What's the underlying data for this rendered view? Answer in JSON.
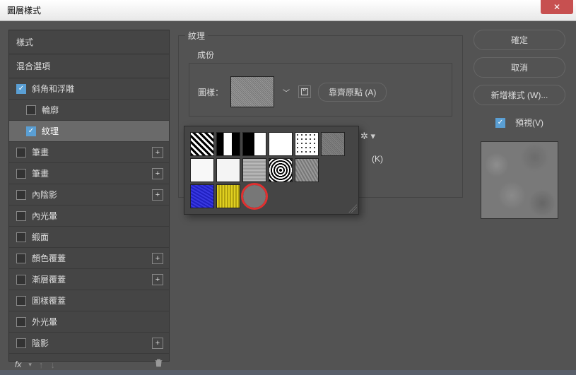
{
  "window": {
    "title": "圖層樣式"
  },
  "left": {
    "styles_header": "樣式",
    "blending_options": "混合選項",
    "items": [
      {
        "label": "斜角和浮雕",
        "checked": true,
        "selected": false,
        "indent": false,
        "add": false
      },
      {
        "label": "輪廓",
        "checked": false,
        "selected": false,
        "indent": true,
        "add": false
      },
      {
        "label": "紋理",
        "checked": true,
        "selected": true,
        "indent": true,
        "add": false
      },
      {
        "label": "筆畫",
        "checked": false,
        "selected": false,
        "indent": false,
        "add": true
      },
      {
        "label": "筆畫",
        "checked": false,
        "selected": false,
        "indent": false,
        "add": true
      },
      {
        "label": "內陰影",
        "checked": false,
        "selected": false,
        "indent": false,
        "add": true
      },
      {
        "label": "內光暈",
        "checked": false,
        "selected": false,
        "indent": false,
        "add": false
      },
      {
        "label": "緞面",
        "checked": false,
        "selected": false,
        "indent": false,
        "add": false
      },
      {
        "label": "顏色覆蓋",
        "checked": false,
        "selected": false,
        "indent": false,
        "add": true
      },
      {
        "label": "漸層覆蓋",
        "checked": false,
        "selected": false,
        "indent": false,
        "add": true
      },
      {
        "label": "圖樣覆蓋",
        "checked": false,
        "selected": false,
        "indent": false,
        "add": false
      },
      {
        "label": "外光暈",
        "checked": false,
        "selected": false,
        "indent": false,
        "add": false
      },
      {
        "label": "陰影",
        "checked": false,
        "selected": false,
        "indent": false,
        "add": true
      }
    ],
    "fx": "fx"
  },
  "texture": {
    "section": "紋理",
    "elements": "成份",
    "pattern_label": "圖樣：",
    "snap_button": "靠齊原點 (A)",
    "shortcut": "(K)"
  },
  "buttons": {
    "ok": "確定",
    "cancel": "取消",
    "new_style": "新增樣式 (W)..."
  },
  "preview": {
    "label": "預視(V)",
    "checked": true
  },
  "picker": {
    "selected_index": 14,
    "swatches": [
      "diag",
      "bars",
      "halfbw",
      "white",
      "dots",
      "noise",
      "white2",
      "white3",
      "grain",
      "rings",
      "waves",
      "empty",
      "blue",
      "yellow",
      "gravel"
    ]
  }
}
